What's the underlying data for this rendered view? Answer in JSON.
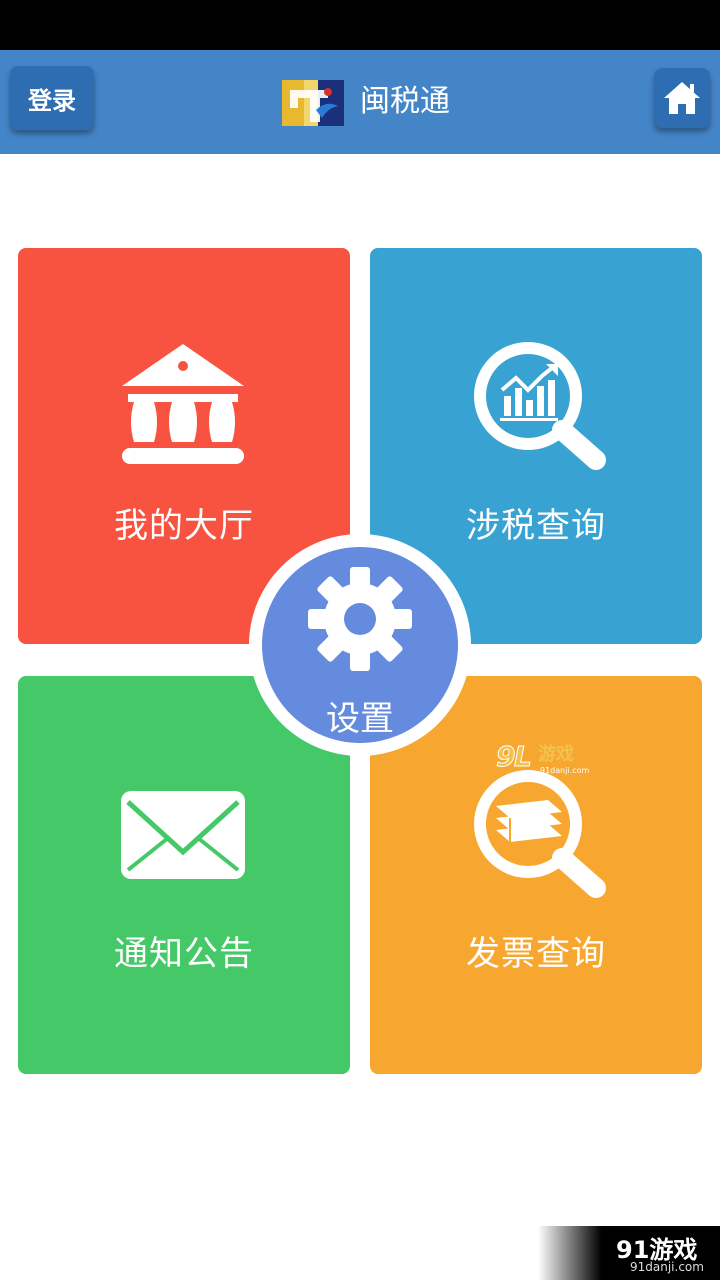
{
  "header": {
    "login_label": "登录",
    "app_title": "闽税通",
    "home_icon": "home-icon",
    "logo": "mst-logo"
  },
  "tiles": {
    "hall": {
      "label": "我的大厅",
      "icon": "bank-icon",
      "color": "#f75340"
    },
    "tax_query": {
      "label": "涉税查询",
      "icon": "chart-search-icon",
      "color": "#38a3d3"
    },
    "notice": {
      "label": "通知公告",
      "icon": "envelope-icon",
      "color": "#45c867"
    },
    "invoice_query": {
      "label": "发票查询",
      "icon": "document-search-icon",
      "color": "#f7a72f"
    }
  },
  "settings": {
    "label": "设置",
    "icon": "gear-icon",
    "color": "#658bde"
  },
  "watermark": {
    "brand": "91游戏",
    "mid_brand": "游戏",
    "domain": "91danji.com"
  },
  "colors": {
    "header_bg": "#4485c8",
    "button_bg": "#2f6db3"
  }
}
